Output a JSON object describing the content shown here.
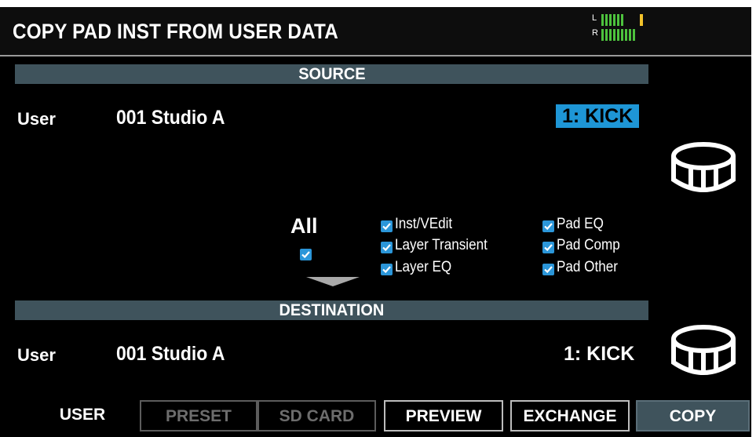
{
  "header": {
    "title": "COPY PAD INST FROM USER DATA",
    "meter": {
      "left_label": "L",
      "right_label": "R"
    }
  },
  "source": {
    "section_label": "SOURCE",
    "bank": "User",
    "kit": "001 Studio A",
    "pad": "1: KICK"
  },
  "options": {
    "all_label": "All",
    "all_checked": true,
    "items": [
      {
        "label": "Inst/VEdit",
        "checked": true
      },
      {
        "label": "Layer Transient",
        "checked": true
      },
      {
        "label": "Layer EQ",
        "checked": true
      },
      {
        "label": "Pad EQ",
        "checked": true
      },
      {
        "label": "Pad Comp",
        "checked": true
      },
      {
        "label": "Pad Other",
        "checked": true
      }
    ]
  },
  "destination": {
    "section_label": "DESTINATION",
    "bank": "User",
    "kit": "001 Studio A",
    "pad": "1: KICK"
  },
  "tabs": {
    "user": "USER",
    "preset": "PRESET",
    "sd_card": "SD CARD",
    "preview": "PREVIEW",
    "exchange": "EXCHANGE",
    "copy": "COPY"
  },
  "colors": {
    "highlight": "#1e96d6",
    "section_bar": "#3f535c",
    "checkbox": "#2b96d9",
    "meter_green": "#4dc23d",
    "meter_peak": "#f2c22b"
  },
  "icons": {
    "drum": "drum-icon",
    "checkbox": "checkbox-checked-icon",
    "arrow": "arrow-down-icon"
  }
}
